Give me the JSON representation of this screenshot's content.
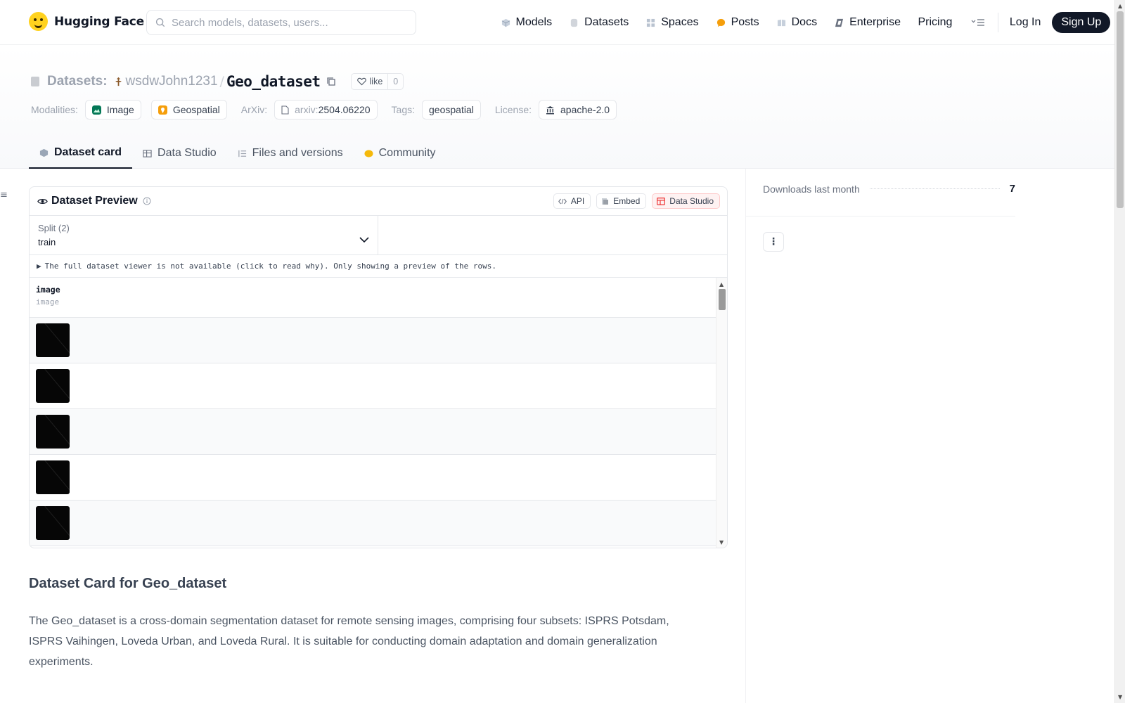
{
  "brand": {
    "name": "Hugging Face"
  },
  "search": {
    "placeholder": "Search models, datasets, users..."
  },
  "nav": {
    "items": [
      {
        "label": "Models",
        "icon": "cube-icon",
        "color": "#a5b4c8"
      },
      {
        "label": "Datasets",
        "icon": "database-icon",
        "color": "#c7cbd1"
      },
      {
        "label": "Spaces",
        "icon": "grid-icon",
        "color": "#a5b4c8"
      },
      {
        "label": "Posts",
        "icon": "chat-bubble-icon",
        "color": "#f59e0b"
      },
      {
        "label": "Docs",
        "icon": "book-icon",
        "color": "#a5b4c8"
      },
      {
        "label": "Enterprise",
        "icon": "enterprise-icon",
        "color": "#6b7280"
      }
    ],
    "pricing": "Pricing",
    "login": "Log In",
    "signup": "Sign Up"
  },
  "repo": {
    "type_label": "Datasets:",
    "user": "wsdwJohn1231",
    "slash": "/",
    "name": "Geo_dataset",
    "like_label": "like",
    "like_count": "0"
  },
  "meta": {
    "modalities_label": "Modalities:",
    "modalities": [
      {
        "label": "Image",
        "color": "#10b981"
      },
      {
        "label": "Geospatial",
        "color": "#f59e0b"
      }
    ],
    "arxiv_label": "ArXiv:",
    "arxiv_prefix": "arxiv:",
    "arxiv_id": "2504.06220",
    "tags_label": "Tags:",
    "tags": [
      "geospatial"
    ],
    "license_label": "License:",
    "license": "apache-2.0"
  },
  "tabs": [
    {
      "label": "Dataset card",
      "active": true
    },
    {
      "label": "Data Studio",
      "active": false
    },
    {
      "label": "Files and versions",
      "active": false
    },
    {
      "label": "Community",
      "active": false
    }
  ],
  "preview": {
    "title": "Dataset Preview",
    "api": "API",
    "embed": "Embed",
    "data_studio": "Data Studio",
    "split_label": "Split (2)",
    "split_value": "train",
    "notice": "The full dataset viewer is not available (click to read why). Only showing a preview of the rows.",
    "column_name": "image",
    "column_type": "image",
    "row_count_visible": 5
  },
  "card": {
    "title": "Dataset Card for Geo_dataset",
    "body": "The Geo_dataset is a cross-domain segmentation dataset for remote sensing images, comprising four subsets: ISPRS Potsdam, ISPRS Vaihingen, Loveda Urban, and Loveda Rural. It is suitable for conducting domain adaptation and domain generalization experiments."
  },
  "stats": {
    "downloads_label": "Downloads last month",
    "downloads_value": "7"
  }
}
